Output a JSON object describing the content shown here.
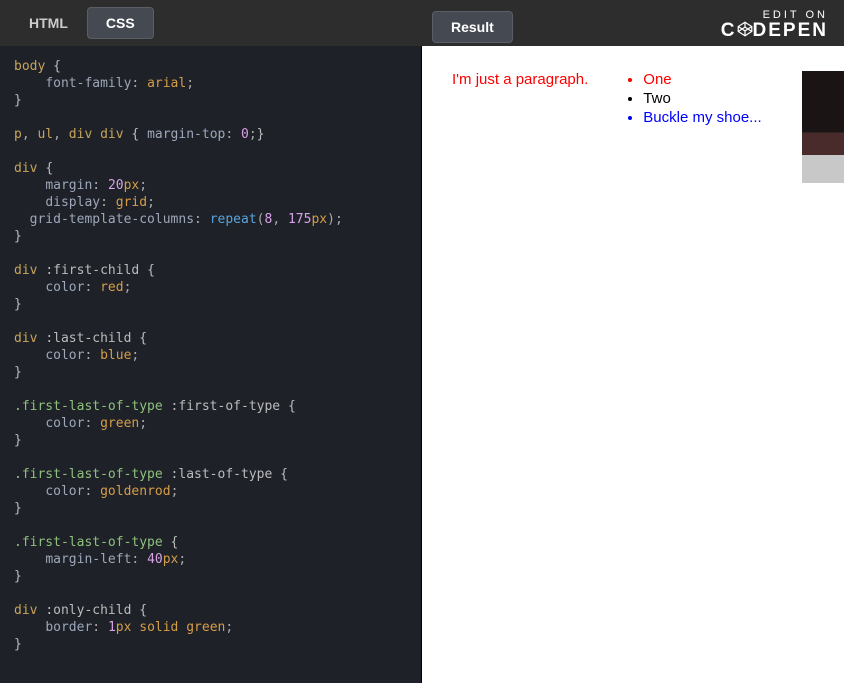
{
  "branding": {
    "edit_on": "EDIT ON",
    "brand": "C  DEPEN"
  },
  "tabs": {
    "html": "HTML",
    "css": "CSS",
    "result": "Result"
  },
  "editor": {
    "code": [
      {
        "t": "sel",
        "v": "body"
      },
      {
        "t": "sp"
      },
      {
        "t": "brace",
        "v": "{"
      },
      {
        "t": "nl"
      },
      {
        "t": "ind"
      },
      {
        "t": "prop",
        "v": "font-family"
      },
      {
        "t": "punct",
        "v": ":"
      },
      {
        "t": "sp"
      },
      {
        "t": "val",
        "v": "arial"
      },
      {
        "t": "punct",
        "v": ";"
      },
      {
        "t": "nl"
      },
      {
        "t": "brace",
        "v": "}"
      },
      {
        "t": "nl"
      },
      {
        "t": "nl"
      },
      {
        "t": "sel",
        "v": "p"
      },
      {
        "t": "punct",
        "v": ","
      },
      {
        "t": "sp"
      },
      {
        "t": "sel",
        "v": "ul"
      },
      {
        "t": "punct",
        "v": ","
      },
      {
        "t": "sp"
      },
      {
        "t": "sel",
        "v": "div div"
      },
      {
        "t": "sp"
      },
      {
        "t": "brace",
        "v": "{"
      },
      {
        "t": "sp"
      },
      {
        "t": "prop",
        "v": "margin-top"
      },
      {
        "t": "punct",
        "v": ":"
      },
      {
        "t": "sp"
      },
      {
        "t": "numv",
        "v": "0"
      },
      {
        "t": "punct",
        "v": ";"
      },
      {
        "t": "brace",
        "v": "}"
      },
      {
        "t": "nl"
      },
      {
        "t": "nl"
      },
      {
        "t": "sel",
        "v": "div"
      },
      {
        "t": "sp"
      },
      {
        "t": "brace",
        "v": "{"
      },
      {
        "t": "nl"
      },
      {
        "t": "ind"
      },
      {
        "t": "prop",
        "v": "margin"
      },
      {
        "t": "punct",
        "v": ":"
      },
      {
        "t": "sp"
      },
      {
        "t": "numv",
        "v": "20"
      },
      {
        "t": "unit",
        "v": "px"
      },
      {
        "t": "punct",
        "v": ";"
      },
      {
        "t": "nl"
      },
      {
        "t": "ind"
      },
      {
        "t": "prop",
        "v": "display"
      },
      {
        "t": "punct",
        "v": ":"
      },
      {
        "t": "sp"
      },
      {
        "t": "val",
        "v": "grid"
      },
      {
        "t": "punct",
        "v": ";"
      },
      {
        "t": "nl"
      },
      {
        "t": "ind2"
      },
      {
        "t": "prop",
        "v": "grid-template-columns"
      },
      {
        "t": "punct",
        "v": ":"
      },
      {
        "t": "sp"
      },
      {
        "t": "kw",
        "v": "repeat"
      },
      {
        "t": "punct",
        "v": "("
      },
      {
        "t": "numv",
        "v": "8"
      },
      {
        "t": "punct",
        "v": ","
      },
      {
        "t": "sp"
      },
      {
        "t": "numv",
        "v": "175"
      },
      {
        "t": "unit",
        "v": "px"
      },
      {
        "t": "punct",
        "v": ")"
      },
      {
        "t": "punct",
        "v": ";"
      },
      {
        "t": "nl"
      },
      {
        "t": "brace",
        "v": "}"
      },
      {
        "t": "nl"
      },
      {
        "t": "nl"
      },
      {
        "t": "sel",
        "v": "div "
      },
      {
        "t": "pseudo",
        "v": ":first-child"
      },
      {
        "t": "sp"
      },
      {
        "t": "brace",
        "v": "{"
      },
      {
        "t": "nl"
      },
      {
        "t": "ind"
      },
      {
        "t": "prop",
        "v": "color"
      },
      {
        "t": "punct",
        "v": ":"
      },
      {
        "t": "sp"
      },
      {
        "t": "val",
        "v": "red"
      },
      {
        "t": "punct",
        "v": ";"
      },
      {
        "t": "nl"
      },
      {
        "t": "brace",
        "v": "}"
      },
      {
        "t": "nl"
      },
      {
        "t": "nl"
      },
      {
        "t": "sel",
        "v": "div "
      },
      {
        "t": "pseudo",
        "v": ":last-child"
      },
      {
        "t": "sp"
      },
      {
        "t": "brace",
        "v": "{"
      },
      {
        "t": "nl"
      },
      {
        "t": "ind"
      },
      {
        "t": "prop",
        "v": "color"
      },
      {
        "t": "punct",
        "v": ":"
      },
      {
        "t": "sp"
      },
      {
        "t": "val",
        "v": "blue"
      },
      {
        "t": "punct",
        "v": ";"
      },
      {
        "t": "nl"
      },
      {
        "t": "brace",
        "v": "}"
      },
      {
        "t": "nl"
      },
      {
        "t": "nl"
      },
      {
        "t": "cls",
        "v": ".first-last-of-type "
      },
      {
        "t": "pseudo",
        "v": ":first-of-type"
      },
      {
        "t": "sp"
      },
      {
        "t": "brace",
        "v": "{"
      },
      {
        "t": "nl"
      },
      {
        "t": "ind"
      },
      {
        "t": "prop",
        "v": "color"
      },
      {
        "t": "punct",
        "v": ":"
      },
      {
        "t": "sp"
      },
      {
        "t": "val",
        "v": "green"
      },
      {
        "t": "punct",
        "v": ";"
      },
      {
        "t": "nl"
      },
      {
        "t": "brace",
        "v": "}"
      },
      {
        "t": "nl"
      },
      {
        "t": "nl"
      },
      {
        "t": "cls",
        "v": ".first-last-of-type "
      },
      {
        "t": "pseudo",
        "v": ":last-of-type"
      },
      {
        "t": "sp"
      },
      {
        "t": "brace",
        "v": "{"
      },
      {
        "t": "nl"
      },
      {
        "t": "ind"
      },
      {
        "t": "prop",
        "v": "color"
      },
      {
        "t": "punct",
        "v": ":"
      },
      {
        "t": "sp"
      },
      {
        "t": "val",
        "v": "goldenrod"
      },
      {
        "t": "punct",
        "v": ";"
      },
      {
        "t": "nl"
      },
      {
        "t": "brace",
        "v": "}"
      },
      {
        "t": "nl"
      },
      {
        "t": "nl"
      },
      {
        "t": "cls",
        "v": ".first-last-of-type"
      },
      {
        "t": "sp"
      },
      {
        "t": "brace",
        "v": "{"
      },
      {
        "t": "nl"
      },
      {
        "t": "ind"
      },
      {
        "t": "prop",
        "v": "margin-left"
      },
      {
        "t": "punct",
        "v": ":"
      },
      {
        "t": "sp"
      },
      {
        "t": "numv",
        "v": "40"
      },
      {
        "t": "unit",
        "v": "px"
      },
      {
        "t": "punct",
        "v": ";"
      },
      {
        "t": "nl"
      },
      {
        "t": "brace",
        "v": "}"
      },
      {
        "t": "nl"
      },
      {
        "t": "nl"
      },
      {
        "t": "sel",
        "v": "div "
      },
      {
        "t": "pseudo",
        "v": ":only-child"
      },
      {
        "t": "sp"
      },
      {
        "t": "brace",
        "v": "{"
      },
      {
        "t": "nl"
      },
      {
        "t": "ind"
      },
      {
        "t": "prop",
        "v": "border"
      },
      {
        "t": "punct",
        "v": ":"
      },
      {
        "t": "sp"
      },
      {
        "t": "numv",
        "v": "1"
      },
      {
        "t": "unit",
        "v": "px"
      },
      {
        "t": "sp"
      },
      {
        "t": "val",
        "v": "solid"
      },
      {
        "t": "sp"
      },
      {
        "t": "val",
        "v": "green"
      },
      {
        "t": "punct",
        "v": ";"
      },
      {
        "t": "nl"
      },
      {
        "t": "brace",
        "v": "}"
      }
    ]
  },
  "result": {
    "paragraph": "I'm just a paragraph.",
    "list": {
      "one": "One",
      "two": "Two",
      "three": "Buckle my shoe..."
    }
  }
}
